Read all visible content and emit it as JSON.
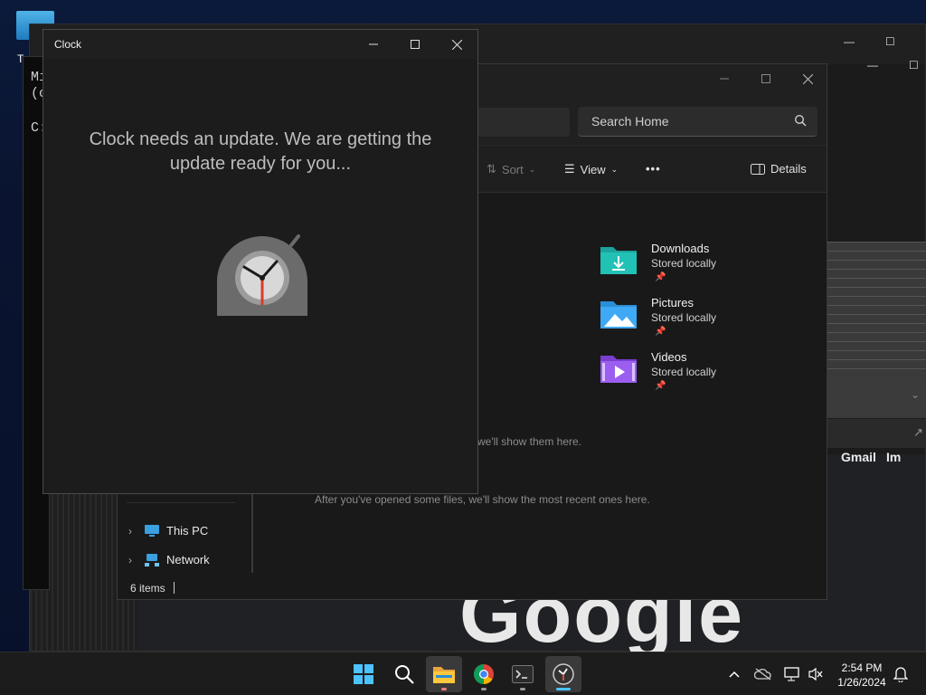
{
  "desktop": {
    "icon_label": "T"
  },
  "terminal": {
    "lines": [
      "Mi",
      "(c",
      "C:"
    ]
  },
  "browser": {
    "gmail": "Gmail",
    "images": "Im",
    "logo": "Google"
  },
  "explorer": {
    "search_placeholder": "Search Home",
    "toolbar": {
      "sort": "Sort",
      "view": "View",
      "more": "•••",
      "details": "Details"
    },
    "quick_access": [
      {
        "name": "Downloads",
        "status": "Stored locally",
        "icon": "downloads-folder-icon",
        "color": "#1ba39c"
      },
      {
        "name": "Pictures",
        "status": "Stored locally",
        "icon": "pictures-folder-icon",
        "color": "#2a8fd6"
      },
      {
        "name": "Videos",
        "status": "Stored locally",
        "icon": "videos-folder-icon",
        "color": "#8a4fd6"
      }
    ],
    "favorites_empty": "we'll show them here.",
    "recent_empty": "After you've opened some files, we'll show the most recent ones here.",
    "nav": [
      {
        "label": "This PC",
        "icon": "this-pc-icon"
      },
      {
        "label": "Network",
        "icon": "network-icon"
      }
    ],
    "status": "6 items"
  },
  "clock_app": {
    "title": "Clock",
    "message": "Clock needs an update. We are getting the update ready for you..."
  },
  "taskbar": {
    "apps": [
      "start-icon",
      "search-icon",
      "file-explorer-icon",
      "chrome-icon",
      "terminal-icon",
      "clock-app-icon"
    ],
    "time": "2:54 PM",
    "date": "1/26/2024"
  }
}
